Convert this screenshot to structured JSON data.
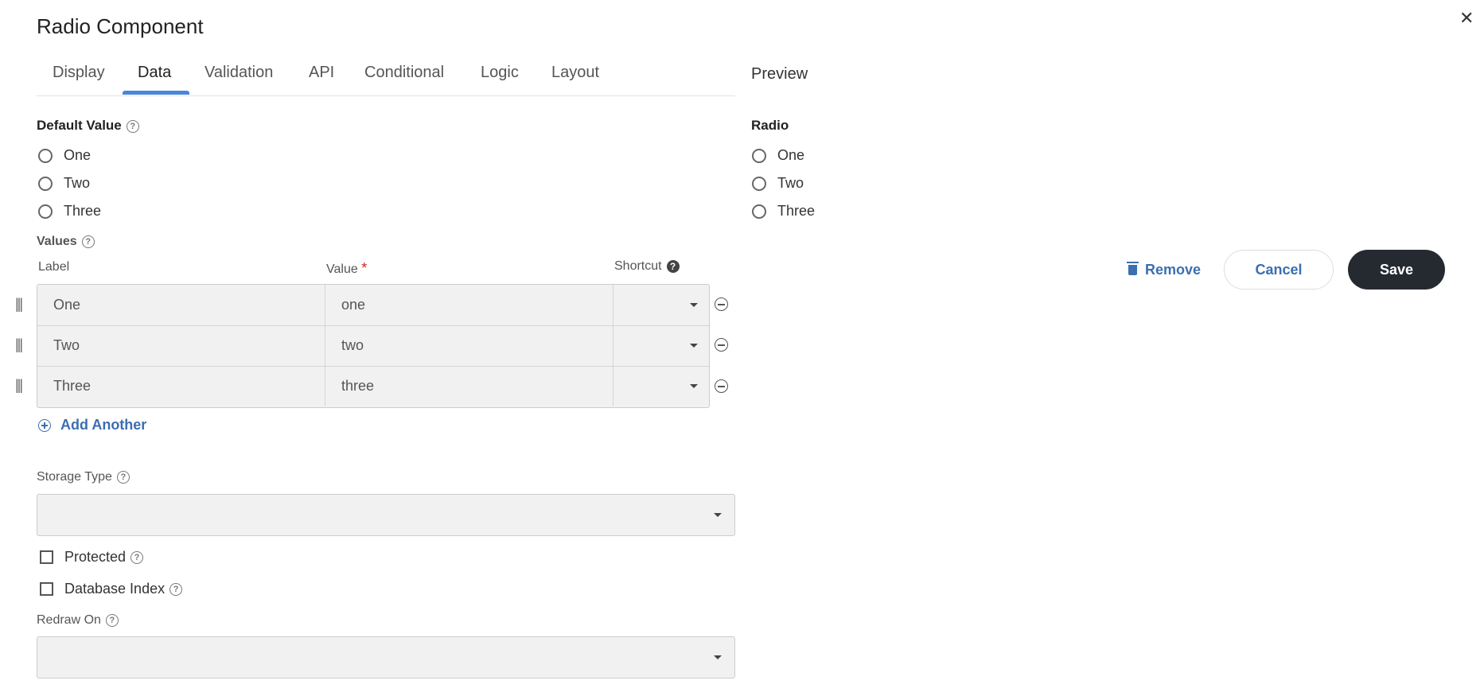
{
  "dialog": {
    "title": "Radio Component",
    "close_glyph": "✕"
  },
  "tabs": [
    {
      "label": "Display"
    },
    {
      "label": "Data",
      "active": true
    },
    {
      "label": "Validation"
    },
    {
      "label": "API"
    },
    {
      "label": "Conditional"
    },
    {
      "label": "Logic"
    },
    {
      "label": "Layout"
    }
  ],
  "default_value": {
    "label": "Default Value",
    "options": [
      "One",
      "Two",
      "Three"
    ]
  },
  "values": {
    "label": "Values",
    "columns": {
      "label": "Label",
      "value": "Value",
      "required_mark": "*",
      "shortcut": "Shortcut"
    },
    "rows": [
      {
        "label": "One",
        "value": "one",
        "shortcut": ""
      },
      {
        "label": "Two",
        "value": "two",
        "shortcut": ""
      },
      {
        "label": "Three",
        "value": "three",
        "shortcut": ""
      }
    ],
    "add_another": "Add Another"
  },
  "storage_type": {
    "label": "Storage Type",
    "value": ""
  },
  "protected": {
    "label": "Protected",
    "checked": false
  },
  "database_index": {
    "label": "Database Index",
    "checked": false
  },
  "redraw_on": {
    "label": "Redraw On",
    "value": ""
  },
  "preview": {
    "title": "Preview",
    "field_label": "Radio",
    "options": [
      "One",
      "Two",
      "Three"
    ]
  },
  "actions": {
    "remove": "Remove",
    "cancel": "Cancel",
    "save": "Save"
  },
  "colors": {
    "accent": "#3b6fb0",
    "tab_underline": "#4a86d8",
    "save_bg": "#252a31",
    "required": "#d9201f"
  }
}
